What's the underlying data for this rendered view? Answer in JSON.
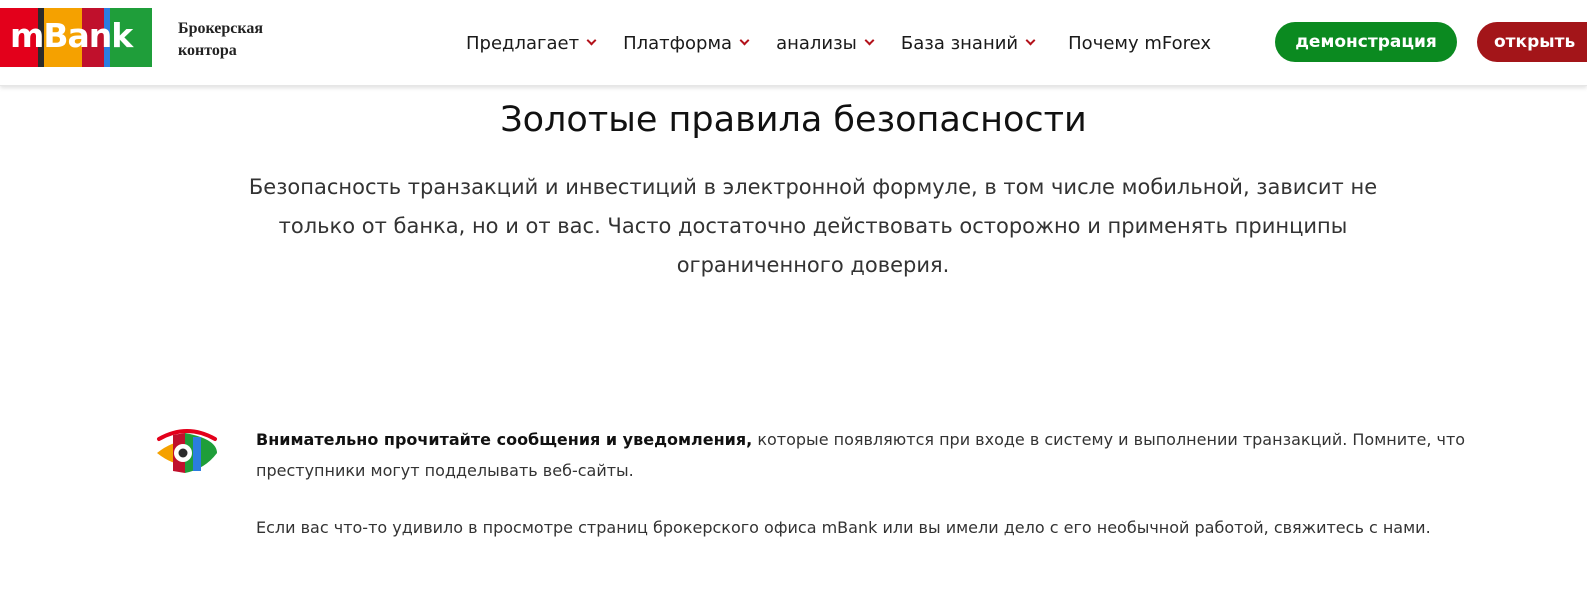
{
  "header": {
    "logo_text": "mBank",
    "logo_colors": [
      "#e3001b",
      "#2b2b2b",
      "#f5a100",
      "#c0102c",
      "#2b7de0",
      "#1f9e3a"
    ],
    "brand_subtitle_line1": "Брокерская",
    "brand_subtitle_line2": "контора",
    "nav": [
      {
        "label": "Предлагает",
        "has_dropdown": true
      },
      {
        "label": "Платформа",
        "has_dropdown": true
      },
      {
        "label": "анализы",
        "has_dropdown": true
      },
      {
        "label": "База знаний",
        "has_dropdown": true
      },
      {
        "label": "Почему mForex",
        "has_dropdown": false
      }
    ],
    "demo_button": "демонстрация",
    "open_button": "открыть",
    "accent_green": "#0b8a20",
    "accent_red": "#a31519"
  },
  "main": {
    "title": "Золотые правила безопасности",
    "intro": "Безопасность транзакций и инвестиций в электронной формуле, в том числе мобильной, зависит не только от банка, но и от вас. Часто достаточно действовать осторожно и применять принципы ограниченного доверия.",
    "rule": {
      "icon": "eye-icon",
      "bold_text": "Внимательно прочитайте сообщения и уведомления,",
      "text": " которые появляются при входе в систему и выполнении транзакций. Помните, что преступники могут подделывать веб-сайты.",
      "second_paragraph": "Если вас что-то удивило в просмотре страниц брокерского офиса mBank или вы имели дело с его необычной работой, свяжитесь с нами."
    }
  }
}
